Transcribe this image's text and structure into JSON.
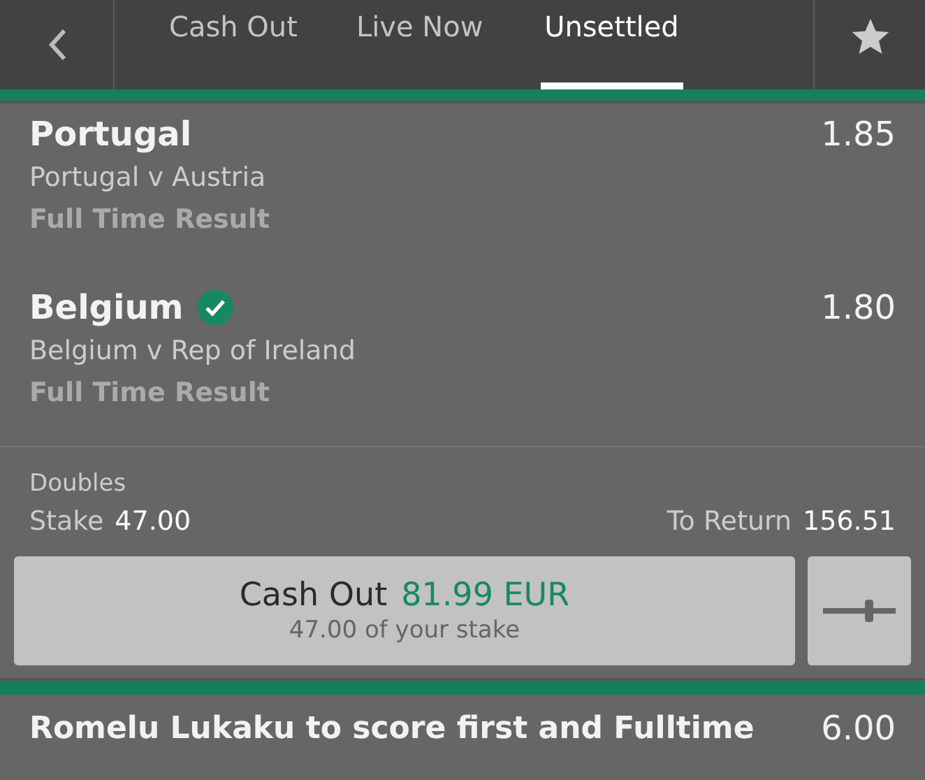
{
  "tabs": [
    {
      "label": "Cash Out",
      "selected": false
    },
    {
      "label": "Live Now",
      "selected": false
    },
    {
      "label": "Unsettled",
      "selected": true
    }
  ],
  "selections": [
    {
      "name": "Portugal",
      "won": false,
      "odds": "1.85",
      "event": "Portugal v Austria",
      "market": "Full Time Result"
    },
    {
      "name": "Belgium",
      "won": true,
      "odds": "1.80",
      "event": "Belgium v Rep of Ireland",
      "market": "Full Time Result"
    }
  ],
  "bet": {
    "type": "Doubles",
    "stake_label": "Stake",
    "stake": "47.00",
    "return_label": "To Return",
    "return": "156.51",
    "cashout_label": "Cash Out",
    "cashout_amount": "81.99 EUR",
    "cashout_note": "47.00 of your stake"
  },
  "next_bet": {
    "name": "Romelu Lukaku to score first and Fulltime",
    "odds": "6.00"
  }
}
